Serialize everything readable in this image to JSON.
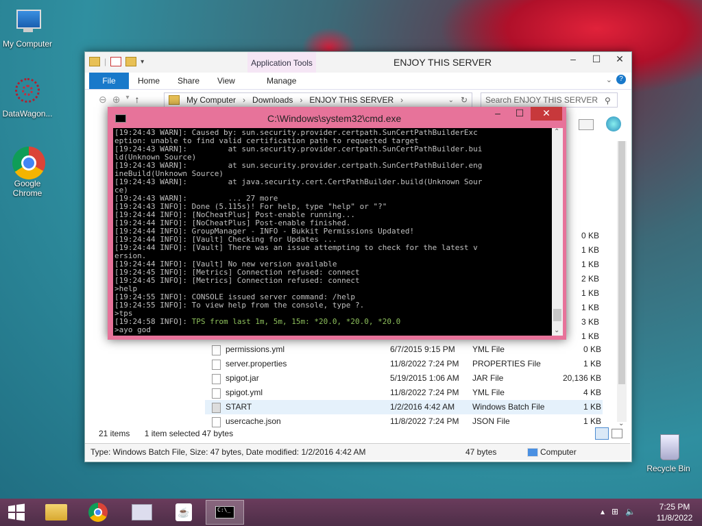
{
  "desktop": {
    "icons": [
      {
        "label": "My Computer"
      },
      {
        "label": "DataWagon..."
      },
      {
        "label": "Google Chrome"
      },
      {
        "label": "Recycle Bin"
      }
    ]
  },
  "explorer": {
    "title": "ENJOY THIS SERVER",
    "app_tools": "Application Tools",
    "tabs": [
      "File",
      "Home",
      "Share",
      "View",
      "Manage"
    ],
    "breadcrumb": [
      "My Computer",
      "Downloads",
      "ENJOY THIS SERVER"
    ],
    "search_placeholder": "Search ENJOY THIS SERVER",
    "files": [
      {
        "name": "permissions.yml",
        "date": "6/7/2015 9:15 PM",
        "type": "YML File",
        "size": "0 KB"
      },
      {
        "name": "server.properties",
        "date": "11/8/2022 7:24 PM",
        "type": "PROPERTIES File",
        "size": "1 KB"
      },
      {
        "name": "spigot.jar",
        "date": "5/19/2015 1:06 AM",
        "type": "JAR File",
        "size": "20,136 KB"
      },
      {
        "name": "spigot.yml",
        "date": "11/8/2022 7:24 PM",
        "type": "YML File",
        "size": "4 KB"
      },
      {
        "name": "START",
        "date": "1/2/2016 4:42 AM",
        "type": "Windows Batch File",
        "size": "1 KB"
      },
      {
        "name": "usercache.json",
        "date": "11/8/2022 7:24 PM",
        "type": "JSON File",
        "size": "1 KB"
      }
    ],
    "hidden_sizes": [
      "0 KB",
      "1 KB",
      "1 KB",
      "2 KB",
      "1 KB",
      "1 KB",
      "3 KB",
      "1 KB"
    ],
    "status_items": "21 items",
    "status_selected": "1 item selected  47 bytes",
    "details": "Type: Windows Batch File, Size: 47 bytes, Date modified: 1/2/2016 4:42 AM",
    "details_size": "47 bytes",
    "details_location": "Computer"
  },
  "cmd": {
    "title": "C:\\Windows\\system32\\cmd.exe",
    "lines": [
      "[19:24:43 WARN]: Caused by: sun.security.provider.certpath.SunCertPathBuilderExc",
      "eption: unable to find valid certification path to requested target",
      "[19:24:43 WARN]:         at sun.security.provider.certpath.SunCertPathBuilder.bui",
      "ld(Unknown Source)",
      "[19:24:43 WARN]:         at sun.security.provider.certpath.SunCertPathBuilder.eng",
      "ineBuild(Unknown Source)",
      "[19:24:43 WARN]:         at java.security.cert.CertPathBuilder.build(Unknown Sour",
      "ce)",
      "[19:24:43 WARN]:         ... 27 more",
      "[19:24:43 INFO]: Done (5.115s)! For help, type \"help\" or \"?\"",
      "[19:24:44 INFO]: [NoCheatPlus] Post-enable running...",
      "[19:24:44 INFO]: [NoCheatPlus] Post-enable finished.",
      "[19:24:44 INFO]: GroupManager - INFO - Bukkit Permissions Updated!",
      "[19:24:44 INFO]: [Vault] Checking for Updates ...",
      "[19:24:44 INFO]: [Vault] There was an issue attempting to check for the latest v",
      "ersion.",
      "[19:24:44 INFO]: [Vault] No new version available",
      "[19:24:45 INFO]: [Metrics] Connection refused: connect",
      "[19:24:45 INFO]: [Metrics] Connection refused: connect",
      ">help",
      "[19:24:55 INFO]: CONSOLE issued server command: /help",
      "[19:24:55 INFO]: To view help from the console, type ?.",
      ">tps"
    ],
    "tps_prefix": "[19:24:58 INFO]: ",
    "tps_text": "TPS from last 1m, 5m, 15m: *20.0, *20.0, *20.0",
    "input_line": ">ayo god"
  },
  "taskbar": {
    "time": "7:25 PM",
    "date": "11/8/2022"
  }
}
